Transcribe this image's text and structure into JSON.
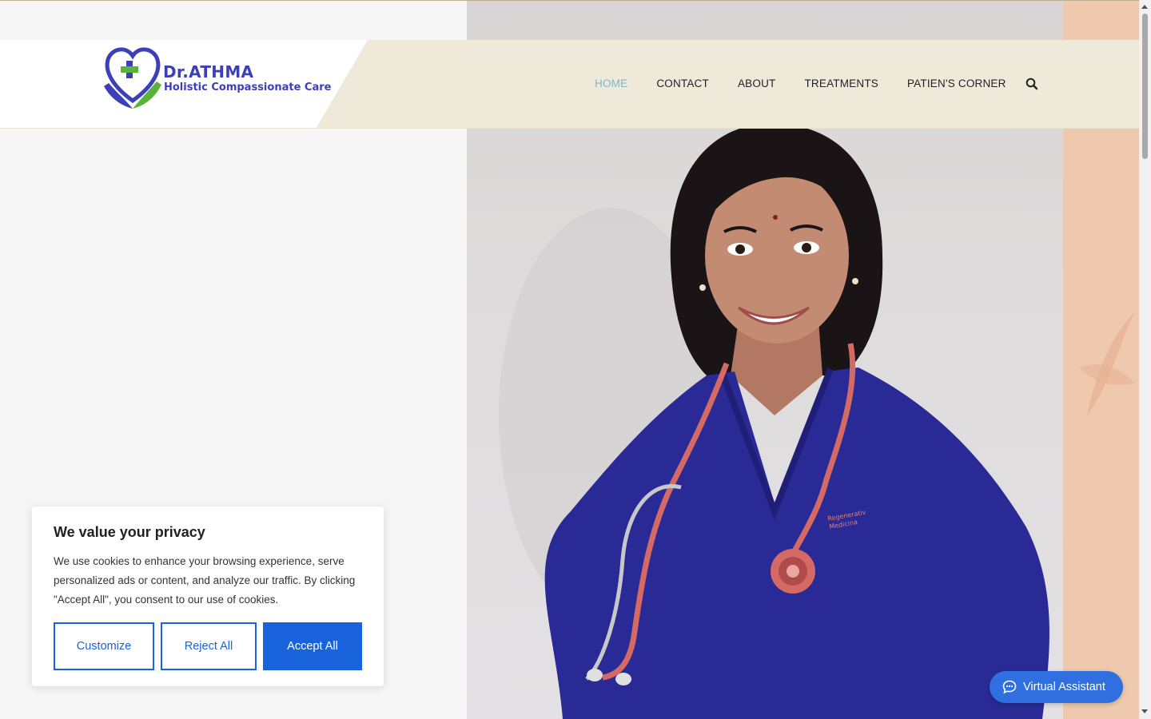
{
  "header": {
    "logo_title": "Dr.ATHMA",
    "logo_subtitle": "Holistic Compassionate Care",
    "nav": [
      {
        "label": "HOME",
        "active": true
      },
      {
        "label": "CONTACT",
        "active": false
      },
      {
        "label": "ABOUT",
        "active": false
      },
      {
        "label": "TREATMENTS",
        "active": false
      },
      {
        "label": "PATIEN'S CORNER",
        "active": false
      }
    ],
    "search_icon": "search-icon"
  },
  "hero": {
    "scrub_embroidery": "Regenerativ Medicina"
  },
  "cookie_banner": {
    "title": "We value your privacy",
    "body": "We use cookies to enhance your browsing experience, serve personalized ads or content, and analyze our traffic. By clicking \"Accept All\", you consent to our use of cookies.",
    "customize_label": "Customize",
    "reject_label": "Reject All",
    "accept_label": "Accept All"
  },
  "virtual_assistant": {
    "label": "Virtual Assistant",
    "icon": "chat-bubble-icon"
  },
  "colors": {
    "nav_active": "#7cb6cc",
    "header_band": "#efe9da",
    "cookie_primary": "#1863dc",
    "assistant": "#2f6fe0",
    "brand_blue": "#3d3fb8",
    "brand_green": "#5ab33c",
    "peach": "#efc9ae",
    "scrubs": "#2a2a96"
  }
}
